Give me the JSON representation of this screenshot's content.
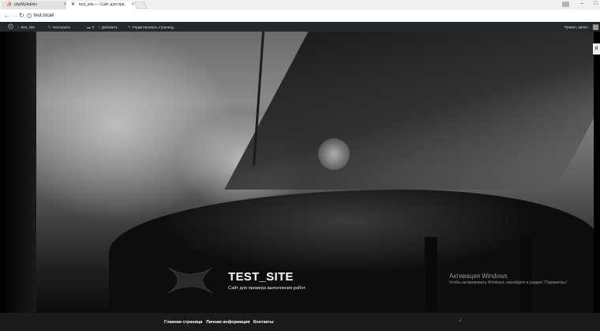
{
  "browser": {
    "tabs": [
      {
        "title": "phpMyAdmin",
        "favicon": "sailboat-icon",
        "active": false
      },
      {
        "title": "test_site — Сайт для при",
        "favicon": "x-logo-icon",
        "active": true
      }
    ],
    "url": "test.local/",
    "window_controls": {
      "minimize": "–",
      "maximize": "□"
    }
  },
  "admin_bar": {
    "items": [
      {
        "label": "test_site",
        "icon": "dashboard-icon"
      },
      {
        "label": "Настроить",
        "icon": "brush-icon"
      },
      {
        "label": "0",
        "icon": "comment-icon"
      },
      {
        "label": "Добавить",
        "icon": "plus-icon"
      },
      {
        "label": "Редактировать страницу",
        "icon": "pencil-icon"
      }
    ],
    "greeting": "Привет, admin"
  },
  "hero": {
    "site_title": "TEST_SITE",
    "site_description": "Сайт для примера выполнения работ",
    "pause_label": "II"
  },
  "watermark": {
    "line1": "Активация Windows",
    "line2": "Чтобы активировать Windows, перейдите в раздел \"Параметры\"."
  },
  "site_nav": {
    "items": [
      "Главная страница",
      "Личная информация",
      "Контакты"
    ],
    "scroll_arrow": "↓"
  }
}
